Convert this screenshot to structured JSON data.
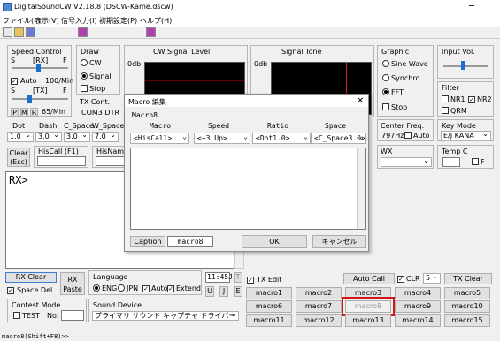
{
  "window": {
    "title": "DigitalSoundCW V2.18.8  (DSCW-Kame.dscw)",
    "minimize": "─"
  },
  "menu": [
    "ファイル(F)",
    "表示(V)",
    "信号入力(I)",
    "初期設定(P)",
    "ヘルプ(H)"
  ],
  "speed_control": {
    "title": "Speed Control",
    "s": "S",
    "rx": "[RX]",
    "f": "F",
    "auto_label": "Auto",
    "rx_speed": "100/Min",
    "tx": "[TX]",
    "p": "P",
    "m": "M",
    "r": "R",
    "tx_speed": "65/Min"
  },
  "draw": {
    "title": "Draw",
    "options": [
      "CW",
      "Signal"
    ],
    "selected": "Signal",
    "stop_label": "Stop"
  },
  "tx_cont": {
    "title": "TX Cont.",
    "value": "COM3 DTR"
  },
  "cw_signal_level": {
    "title": "CW Signal Level",
    "odb": "0db"
  },
  "signal_tone": {
    "title": "Signal Tone",
    "odb": "0db"
  },
  "graphic": {
    "title": "Graphic",
    "options": [
      "Sine Wave",
      "Synchro",
      "FFT"
    ],
    "selected": "FFT",
    "stop_label": "Stop"
  },
  "input_vol": {
    "title": "Input Vol."
  },
  "filter": {
    "title": "Filter",
    "nr1": "NR1",
    "nr2": "NR2",
    "qrm": "QRM"
  },
  "dot": {
    "label": "Dot",
    "value": "1.0"
  },
  "dash": {
    "label": "Dash",
    "value": "3.0"
  },
  "c_space": {
    "label": "C_Space",
    "value": "3.0"
  },
  "w_space": {
    "label": "W_Space",
    "value": "7.0"
  },
  "clear_btn": {
    "line1": "Clear",
    "line2": "(Esc)"
  },
  "hiscall": {
    "label": "HisCall  (F1)"
  },
  "hisname": {
    "label": "HisName"
  },
  "center_freq": {
    "title": "Center Freq.",
    "value": "797Hz",
    "auto": "Auto"
  },
  "key_mode": {
    "title": "Key Mode",
    "value": "E/J KANA"
  },
  "wx": {
    "title": "WX"
  },
  "temp_c": {
    "title": "Temp C",
    "f": "F"
  },
  "rx_prompt": "RX>",
  "dialog": {
    "title": "Macro  編集",
    "name": "Macro8",
    "headers": [
      "Macro",
      "Speed",
      "Ratio",
      "Space"
    ],
    "values": [
      "<HisCall>",
      "<+3 Up>",
      "<Dot1.0>",
      "<C_Space3.0>"
    ],
    "caption_label": "Caption",
    "caption_value": "macro8",
    "ok": "OK",
    "cancel": "キャンセル"
  },
  "rx_clear": "RX Clear",
  "space_del": "Space Del",
  "rx_paste": {
    "line1": "RX",
    "line2": "Paste"
  },
  "language": {
    "title": "Language",
    "options": [
      "ENG",
      "JPN"
    ],
    "selected": "ENG",
    "auto": "Auto",
    "extend": "Extend"
  },
  "time": "11:45J",
  "time_buttons": [
    "T",
    "U",
    "J",
    "E"
  ],
  "tx_edit": "TX Edit",
  "auto_call": "Auto Call",
  "clr": "CLR",
  "repeat": "5",
  "tx_clear": "TX Clear",
  "macros": [
    [
      "macro1",
      "macro2",
      "macro3",
      "macro4",
      "macro5"
    ],
    [
      "macro6",
      "macro7",
      "macro8",
      "macro9",
      "macro10"
    ],
    [
      "macro11",
      "macro12",
      "macro13",
      "macro14",
      "macro15"
    ]
  ],
  "contest": {
    "title": "Contest Mode",
    "test": "TEST",
    "no": "No."
  },
  "sound_device": {
    "title": "Sound Device",
    "value": "プライマリ サウンド キャプチャ ドライバー"
  },
  "status_bar": "macro8(Shift+F8)>>"
}
